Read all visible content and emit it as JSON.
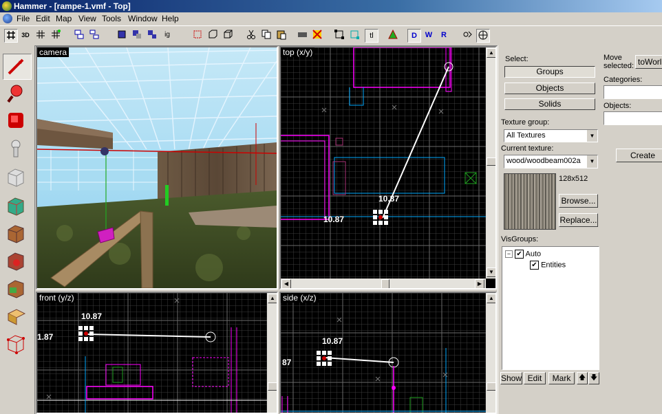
{
  "window": {
    "title": "Hammer - [rampe-1.vmf - Top]"
  },
  "menu": [
    "File",
    "Edit",
    "Map",
    "View",
    "Tools",
    "Window",
    "Help"
  ],
  "toolbar": {
    "icons": [
      "grid-icon",
      "3d-grid-icon",
      "grid-toggle-icon",
      "grid-snap-icon",
      "group-icon",
      "ungroup-icon",
      "hide-icon",
      "hide-objects-icon",
      "ignore-group-icon",
      "carve-icon",
      "hollow-icon",
      "cut-icon",
      "copy-icon",
      "paste-icon",
      "texture-lock-icon",
      "toggle-texture-icon",
      "select-icon",
      "cordon-icon",
      "tl-icon",
      "vertex-icon",
      "toggle-display-icon",
      "flip-h-icon",
      "flip-v-icon",
      "run-map-icon",
      "settings-icon"
    ],
    "tl_label": "tl"
  },
  "tools": [
    "selection-tool",
    "magnify-tool",
    "camera-tool",
    "entity-tool",
    "block-tool",
    "texture-tool",
    "apply-texture-tool",
    "decal-tool",
    "overlay-tool",
    "clipping-tool",
    "vertex-tool"
  ],
  "viewports": {
    "camera": {
      "label": "camera"
    },
    "top": {
      "label": "top (x/y)",
      "dim1": "10.87",
      "dim2": "10.87"
    },
    "front": {
      "label": "front (y/z)",
      "dim1": "10.87",
      "dim2": "1.87"
    },
    "side": {
      "label": "side (x/z)",
      "dim1": "10.87",
      "dim2": "87"
    }
  },
  "panel": {
    "select_label": "Select:",
    "groups": "Groups",
    "objects": "Objects",
    "solids": "Solids",
    "texture_group_label": "Texture group:",
    "texture_group_value": "All Textures",
    "current_texture_label": "Current texture:",
    "current_texture_value": "wood/woodbeam002a",
    "texture_size": "128x512",
    "browse": "Browse...",
    "replace": "Replace...",
    "visgroups_label": "VisGroups:",
    "visgroup_auto": "Auto",
    "visgroup_entities": "Entities",
    "show": "Show",
    "edit": "Edit",
    "mark": "Mark"
  },
  "panel2": {
    "move_selected": "Move selected:",
    "to_world": "toWorld",
    "categories": "Categories:",
    "objects": "Objects:",
    "create_prefab": "Create Pre"
  },
  "colors": {
    "title_bar": "#0a246a",
    "grid_major": "#4a4a4a",
    "brush_outline": "#ff00ff",
    "entity_outline": "#00ffff",
    "selection": "#ff0000"
  }
}
